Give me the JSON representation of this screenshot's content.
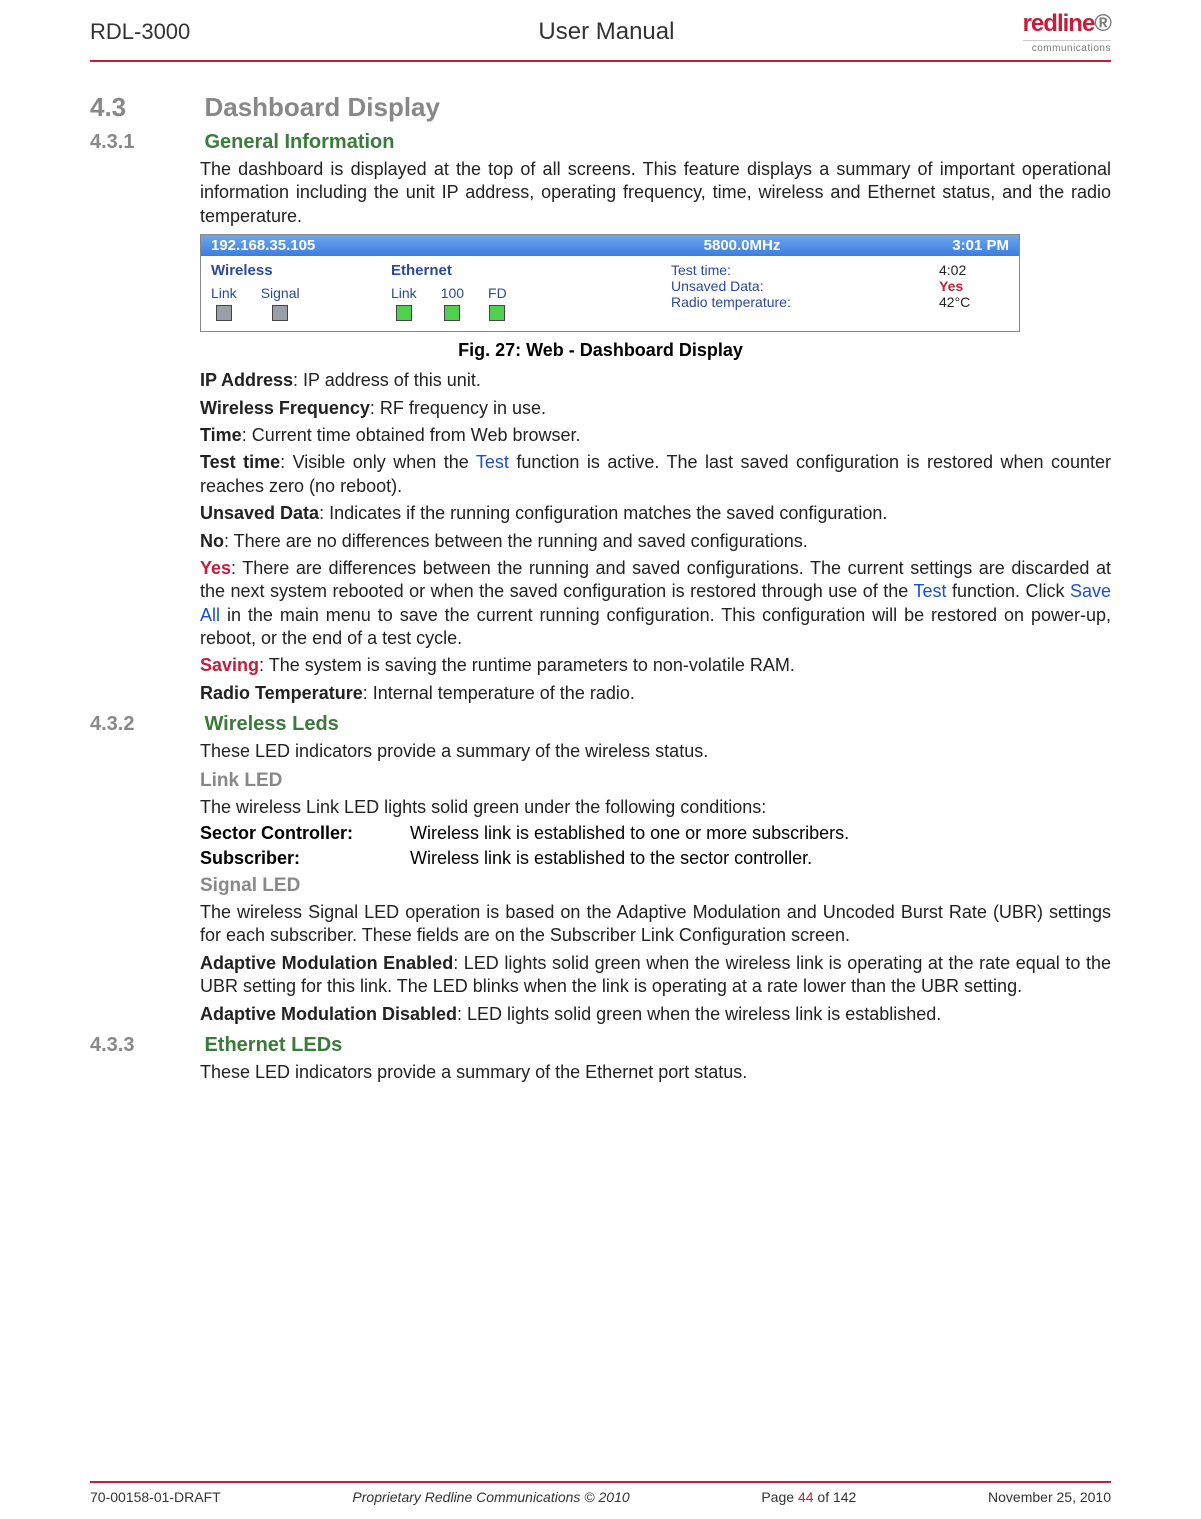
{
  "header": {
    "left": "RDL-3000",
    "center": "User Manual",
    "logo_top": "redline",
    "logo_bottom": "communications"
  },
  "s43": {
    "num": "4.3",
    "title": "Dashboard Display"
  },
  "s431": {
    "num": "4.3.1",
    "title": "General Information",
    "intro": "The dashboard is displayed at the top of all screens. This feature displays a summary of important operational information including the unit IP address, operating frequency, time, wireless and Ethernet status, and the radio temperature."
  },
  "dash": {
    "ip": "192.168.35.105",
    "freq": "5800.0MHz",
    "clock": "3:01 PM",
    "wireless_h": "Wireless",
    "ethernet_h": "Ethernet",
    "link": "Link",
    "signal": "Signal",
    "eth_link": "Link",
    "eth_100": "100",
    "eth_fd": "FD",
    "test_time_l": "Test time:",
    "test_time_v": "4:02",
    "unsaved_l": "Unsaved Data:",
    "unsaved_v": "Yes",
    "temp_l": "Radio temperature:",
    "temp_v": "42°C"
  },
  "fig_caption": "Fig. 27: Web - Dashboard Display",
  "defs": {
    "ip_l": "IP Address",
    "ip_t": ": IP address of this unit.",
    "wf_l": "Wireless Frequency",
    "wf_t": ": RF frequency in use.",
    "time_l": "Time",
    "time_t": ": Current time obtained from Web browser.",
    "tt_l": "Test time",
    "tt_t1": ": Visible only when the ",
    "tt_link": "Test",
    "tt_t2": " function is active. The last saved configuration is restored when counter reaches zero (no reboot).",
    "ud_l": "Unsaved Data",
    "ud_t": ": Indicates if the running configuration matches the saved configuration.",
    "no_l": "No",
    "no_t": ": There are no differences between the running and saved configurations.",
    "yes_l": "Yes",
    "yes_t1": ": There are differences between the running and saved configurations. The current settings are discarded at the next system rebooted or when the saved configuration is restored through use of the ",
    "yes_link1": "Test",
    "yes_t2": " function. Click ",
    "yes_link2": "Save All",
    "yes_t3": " in the main menu to save the current running configuration. This configuration will be restored on power-up, reboot, or the end of a test cycle.",
    "sav_l": "Saving",
    "sav_t": ": The system is saving the runtime parameters to non-volatile RAM.",
    "rt_l": "Radio Temperature",
    "rt_t": ": Internal temperature of the radio."
  },
  "s432": {
    "num": "4.3.2",
    "title": "Wireless Leds",
    "intro": "These LED indicators provide a summary of the wireless status.",
    "link_h": "Link LED",
    "link_t": "The wireless Link LED lights solid green under the following conditions:",
    "sc_l": "Sector Controller",
    "sc_t": "Wireless link is established to one or more subscribers.",
    "sub_l": "Subscriber",
    "sub_t": "Wireless link is established to the sector controller.",
    "signal_h": "Signal LED",
    "signal_t": "The wireless Signal LED operation is based on the Adaptive Modulation and Uncoded Burst Rate (UBR) settings for each subscriber. These fields are on the Subscriber Link Configuration screen.",
    "ame_l": "Adaptive Modulation Enabled",
    "ame_t": ": LED lights solid green when the wireless link is operating at the rate equal to the UBR setting for this link. The LED blinks when the link is operating at a rate lower than the UBR setting.",
    "amd_l": "Adaptive Modulation Disabled",
    "amd_t": ": LED lights solid green when the wireless link is established."
  },
  "s433": {
    "num": "4.3.3",
    "title": "Ethernet LEDs",
    "intro": "These LED indicators provide a summary of the Ethernet port status."
  },
  "footer": {
    "doc": "70-00158-01-DRAFT",
    "prop": "Proprietary Redline Communications © 2010",
    "page_pre": "Page ",
    "page_cur": "44",
    "page_post": " of 142",
    "date": "November 25, 2010"
  }
}
